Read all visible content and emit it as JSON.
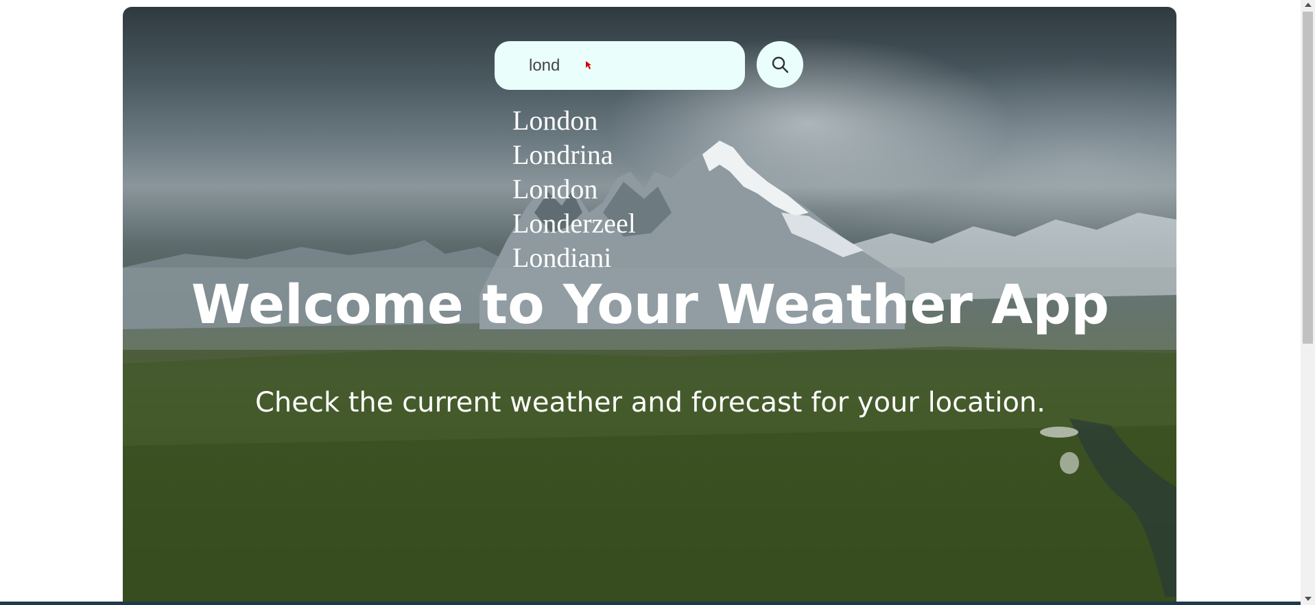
{
  "search": {
    "value": "lond",
    "placeholder": "",
    "button_icon": "search-icon"
  },
  "suggestions": [
    "London",
    "Londrina",
    "London",
    "Londerzeel",
    "Londiani"
  ],
  "hero": {
    "title": "Welcome to Your Weather App",
    "subtitle": "Check the current weather and forecast for your location."
  },
  "colors": {
    "search_bg": "#eafffb",
    "text": "#ffffff"
  }
}
